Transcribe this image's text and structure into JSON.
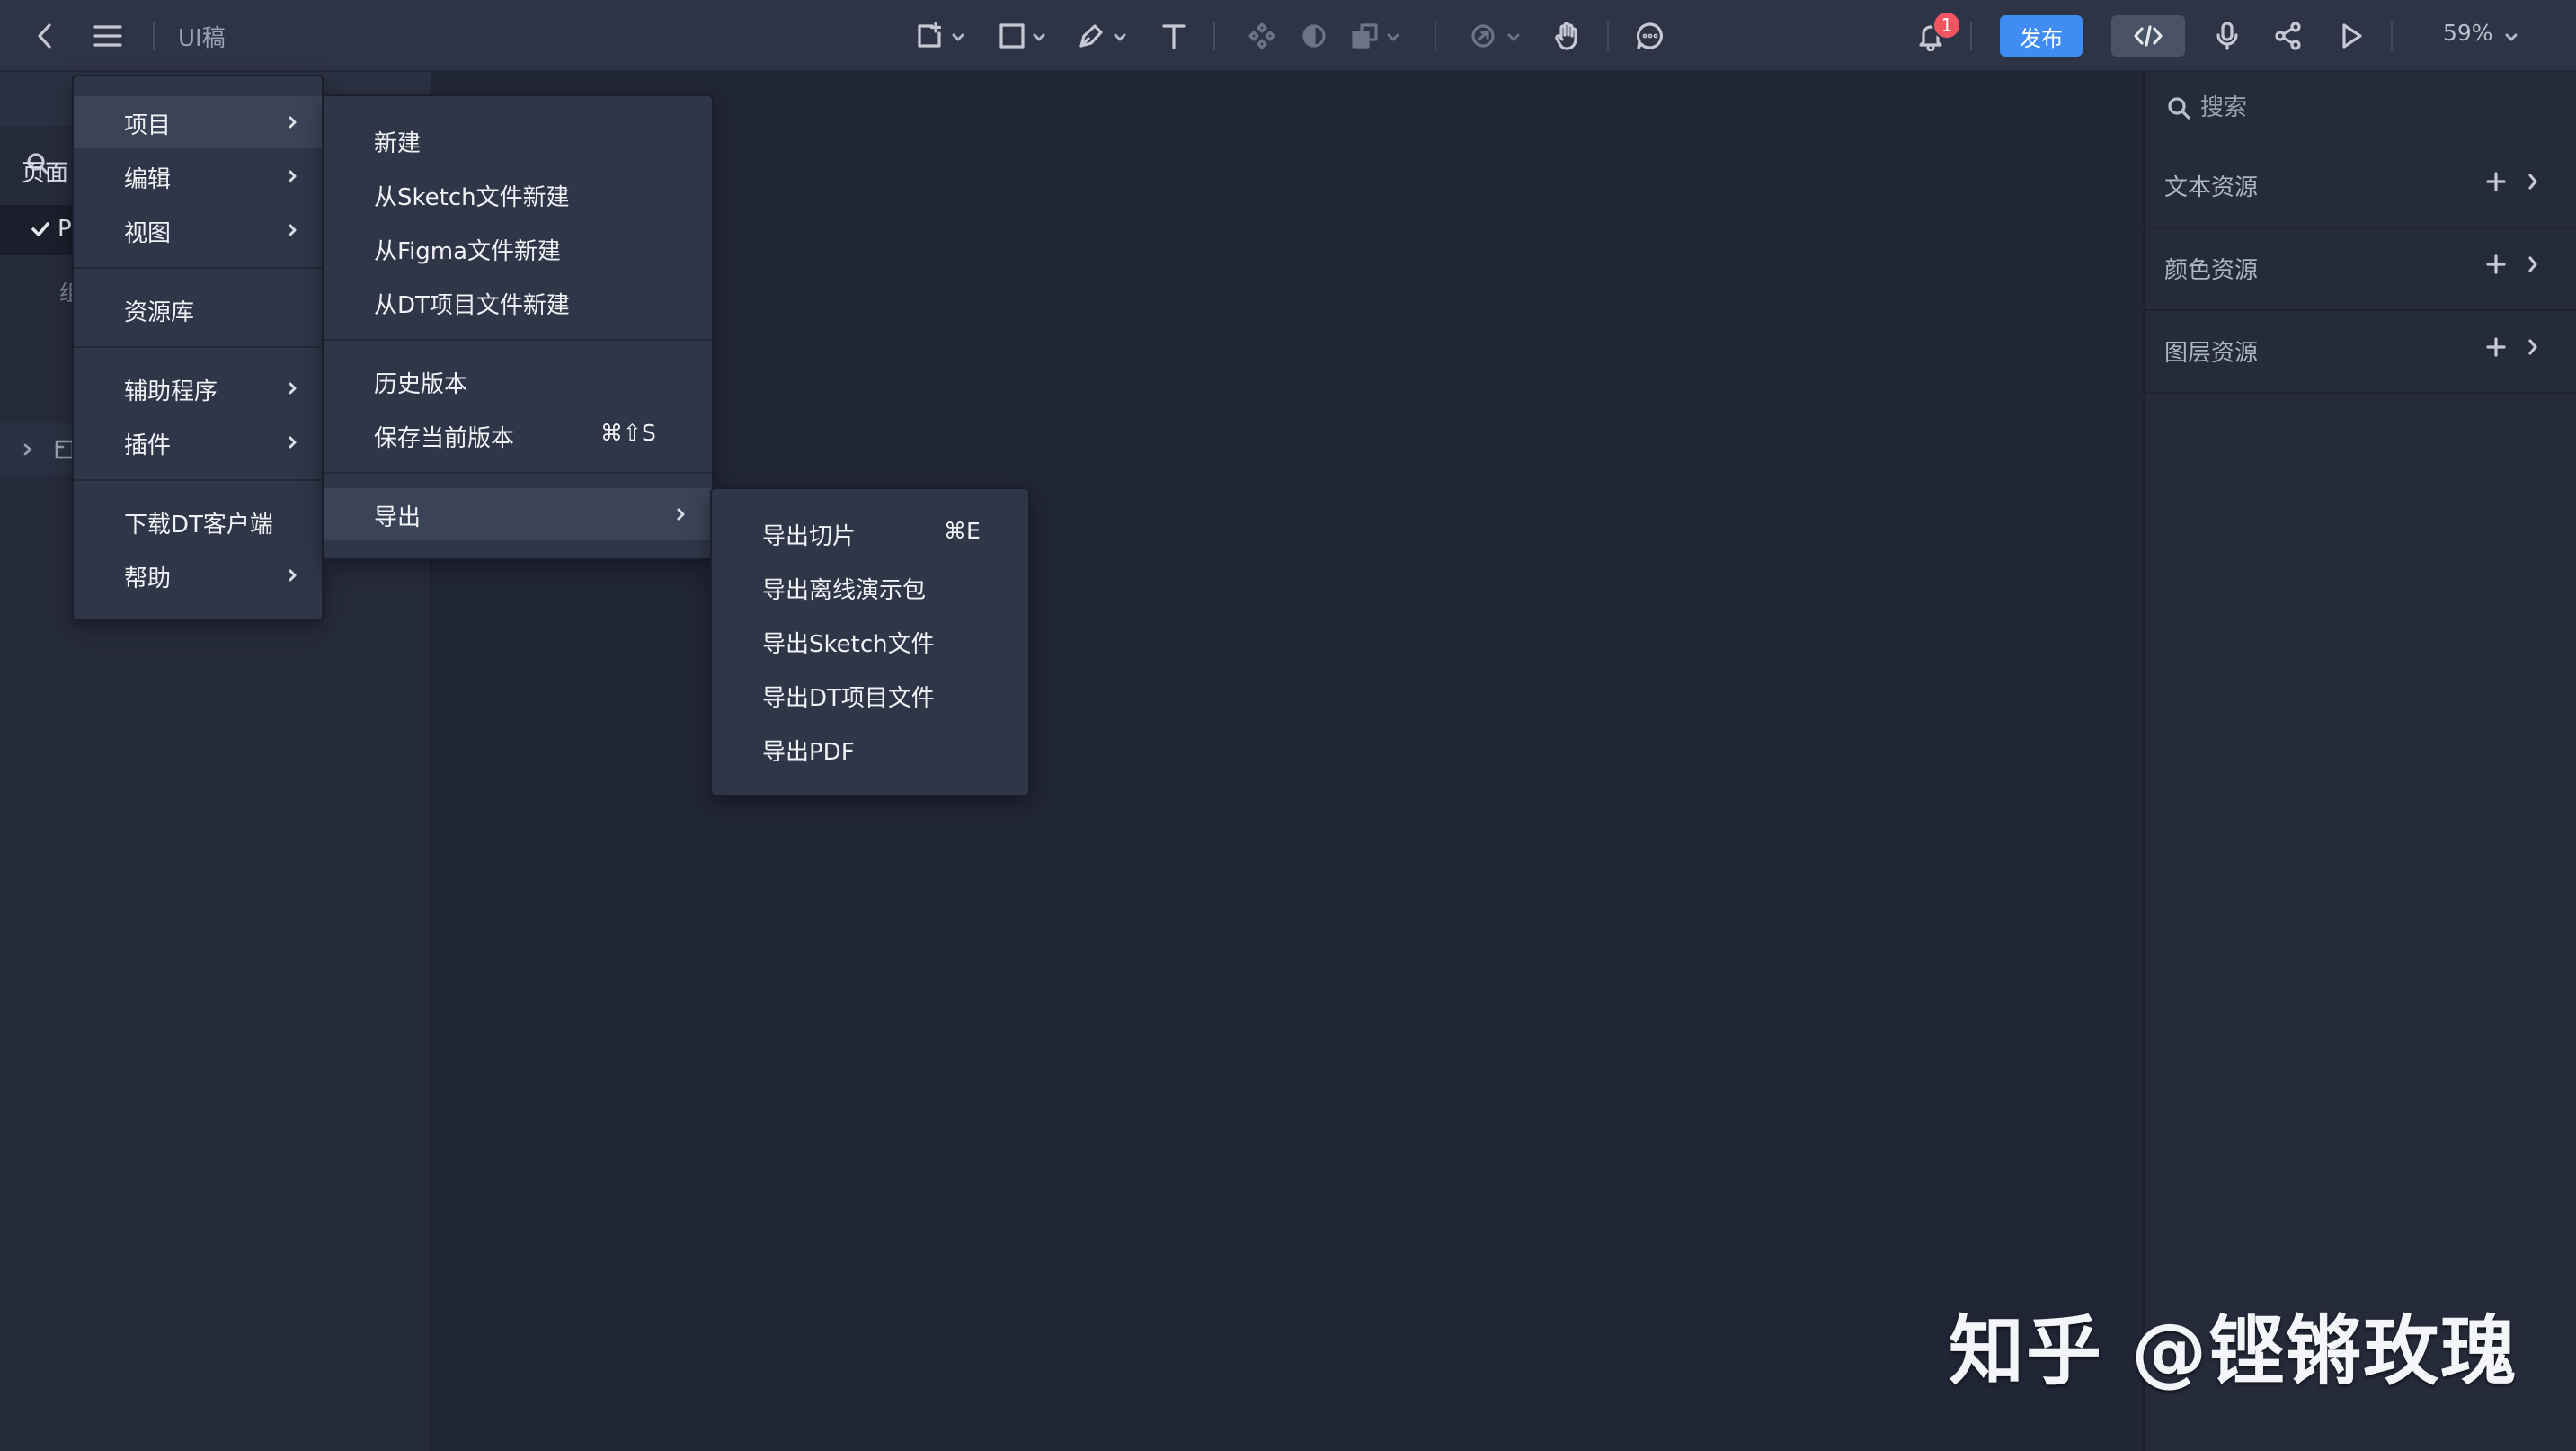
{
  "toolbar": {
    "doc_title": "UI稿",
    "publish_label": "发布",
    "notification_count": "1",
    "zoom_label": "59%",
    "icons": [
      "back-icon",
      "menu-icon",
      "frame-add-icon",
      "rectangle-icon",
      "pen-icon",
      "text-icon",
      "component-icon",
      "mask-icon",
      "boolean-icon",
      "prototype-icon",
      "hand-icon",
      "comment-icon",
      "bell-icon",
      "code-icon",
      "mic-icon",
      "share-icon",
      "play-icon"
    ]
  },
  "left_panel": {
    "pages_label": "页面",
    "page_name": "P",
    "group_label": "组"
  },
  "main_menu": {
    "items": [
      {
        "label": "项目",
        "has_submenu": true,
        "active": true
      },
      {
        "label": "编辑",
        "has_submenu": true
      },
      {
        "label": "视图",
        "has_submenu": true
      },
      {
        "label": "资源库",
        "has_submenu": false
      },
      {
        "label": "辅助程序",
        "has_submenu": true
      },
      {
        "label": "插件",
        "has_submenu": true
      },
      {
        "label": "下载DT客户端",
        "has_submenu": false
      },
      {
        "label": "帮助",
        "has_submenu": true
      }
    ]
  },
  "project_menu": {
    "items": [
      {
        "label": "新建"
      },
      {
        "label": "从Sketch文件新建"
      },
      {
        "label": "从Figma文件新建"
      },
      {
        "label": "从DT项目文件新建"
      },
      {
        "label": "历史版本"
      },
      {
        "label": "保存当前版本",
        "shortcut": "⌘⇧S"
      },
      {
        "label": "导出",
        "has_submenu": true,
        "active": true
      }
    ]
  },
  "export_menu": {
    "items": [
      {
        "label": "导出切片",
        "shortcut": "⌘E"
      },
      {
        "label": "导出离线演示包"
      },
      {
        "label": "导出Sketch文件"
      },
      {
        "label": "导出DT项目文件"
      },
      {
        "label": "导出PDF"
      }
    ]
  },
  "right_panel": {
    "search_placeholder": "搜索",
    "assets": [
      {
        "label": "文本资源"
      },
      {
        "label": "颜色资源"
      },
      {
        "label": "图层资源"
      }
    ]
  },
  "watermark": "知乎 @铿锵玫瑰",
  "colors": {
    "canvas": "#212636",
    "toolbar": "#2e3446",
    "panel": "#262b3b",
    "menu": "#2f3648",
    "accent": "#3f8cf2",
    "badge": "#f05561"
  }
}
